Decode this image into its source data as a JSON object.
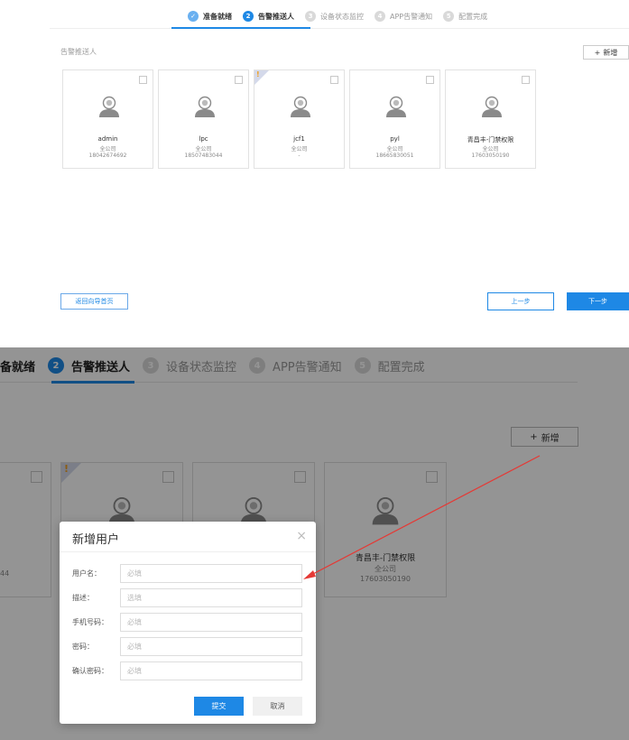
{
  "steps": [
    {
      "num": "✓",
      "label": "准备就绪",
      "state": "done"
    },
    {
      "num": "2",
      "label": "告警推送人",
      "state": "active"
    },
    {
      "num": "3",
      "label": "设备状态监控",
      "state": "todo"
    },
    {
      "num": "4",
      "label": "APP告警通知",
      "state": "todo"
    },
    {
      "num": "5",
      "label": "配置完成",
      "state": "todo"
    }
  ],
  "section_label": "告警推送人",
  "add_button": {
    "icon": "+",
    "label": "新增"
  },
  "users": [
    {
      "name": "admin",
      "org": "全公司",
      "phone": "18042674692",
      "flag": false
    },
    {
      "name": "lpc",
      "org": "全公司",
      "phone": "18507483044",
      "flag": false
    },
    {
      "name": "jcf1",
      "org": "全公司",
      "phone": "-",
      "flag": true
    },
    {
      "name": "pyl",
      "org": "全公司",
      "phone": "18665830051",
      "flag": false
    },
    {
      "name": "青昌丰-门禁权限",
      "org": "全公司",
      "phone": "17603050190",
      "flag": false
    }
  ],
  "footer": {
    "home_label": "返回向导首页",
    "prev_label": "上一步",
    "next_label": "下一步"
  },
  "zoom": {
    "steps": [
      {
        "num": "",
        "label": "备就绪",
        "state": "done"
      },
      {
        "num": "2",
        "label": "告警推送人",
        "state": "active"
      },
      {
        "num": "3",
        "label": "设备状态监控",
        "state": "todo"
      },
      {
        "num": "4",
        "label": "APP告警通知",
        "state": "todo"
      },
      {
        "num": "5",
        "label": "配置完成",
        "state": "todo"
      }
    ],
    "partial_phone": "44",
    "card_name": "青昌丰-门禁权限",
    "card_org": "全公司",
    "card_phone": "17603050190"
  },
  "dialog": {
    "title": "新增用户",
    "close": "×",
    "fields": [
      {
        "label": "用户名：",
        "placeholder": "必填"
      },
      {
        "label": "描述：",
        "placeholder": "选填"
      },
      {
        "label": "手机号码：",
        "placeholder": "必填"
      },
      {
        "label": "密码：",
        "placeholder": "必填"
      },
      {
        "label": "确认密码：",
        "placeholder": "必填"
      }
    ],
    "submit_label": "提交",
    "cancel_label": "取消"
  },
  "colors": {
    "primary": "#1e88e5",
    "annotation_arrow": "#e53935"
  }
}
